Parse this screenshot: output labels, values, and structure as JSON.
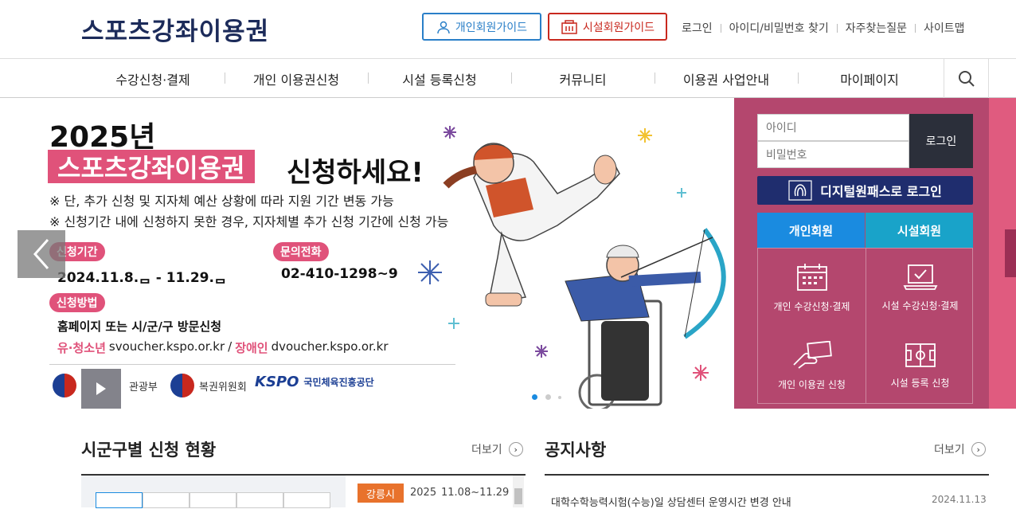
{
  "header": {
    "logo": "스포츠강좌이용권",
    "guide_person": "개인회원가이드",
    "guide_facility": "시설회원가이드",
    "links": [
      "로그인",
      "아이디/비밀번호 찾기",
      "자주찾는질문",
      "사이트맵"
    ]
  },
  "nav": {
    "items": [
      "수강신청·결제",
      "개인 이용권신청",
      "시설 등록신청",
      "커뮤니티",
      "이용권 사업안내",
      "마이페이지"
    ]
  },
  "hero": {
    "year": "2025년",
    "title_highlight": "스포츠강좌이용권",
    "title_rest": "신청하세요!",
    "note1": "※ 단, 추가 신청 및 지자체 예산 상황에 따라 지원 기간 변동 가능",
    "note2": "※ 신청기간 내에 신청하지 못한 경우, 지자체별 추가 신청 기간에 신청 가능",
    "period_label": "신청기간",
    "period_value": "2024.11.8.ᆷ - 11.29.ᆷ",
    "phone_label": "문의전화",
    "phone_value": "02-410-1298~9",
    "method_label": "신청방법",
    "method_value": "홈페이지 또는 시/군/구 방문신청",
    "youth_label": "유·청소년",
    "youth_url": "svoucher.kspo.or.kr",
    "slash": "/",
    "disabled_label": "장애인",
    "disabled_url": "dvoucher.kspo.or.kr",
    "org1": "관광부",
    "org2": "복권위원회",
    "org3_logo": "KSPO",
    "org3": "국민체육진흥공단"
  },
  "login": {
    "id_placeholder": "아이디",
    "pw_placeholder": "비밀번호",
    "login_button": "로그인",
    "digital_button": "디지털원패스로 로그인",
    "tab_person": "개인회원",
    "tab_facility": "시설회원",
    "grid": [
      "개인 수강신청·결제",
      "시설 수강신청·결제",
      "개인 이용권 신청",
      "시설 등록 신청"
    ]
  },
  "status": {
    "title": "시군구별 신청 현황",
    "more": "더보기",
    "region": "강릉시",
    "year": "2025",
    "dates": "11.08~11.29"
  },
  "notice": {
    "title": "공지사항",
    "more": "더보기",
    "item": "대학수학능력시험(수능)일 상담센터 운영시간 변경 안내",
    "date": "2024.11.13"
  },
  "colors": {
    "brand_navy": "#1c2b5a",
    "pink": "#e0527a",
    "panel": "#b4476e",
    "tab_blue": "#1a8be0",
    "tab_teal": "#19a3c9"
  }
}
